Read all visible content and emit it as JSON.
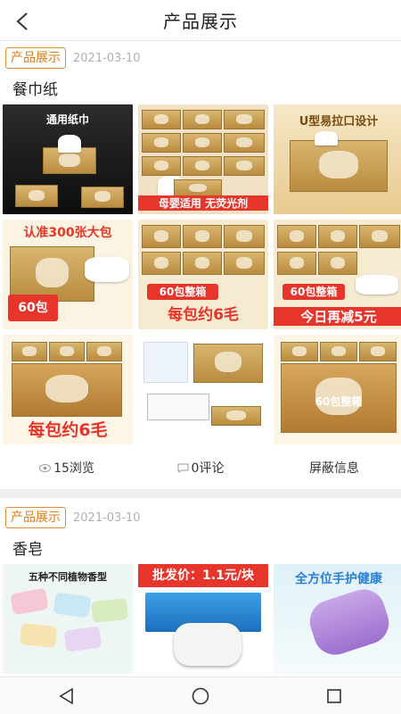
{
  "header": {
    "title": "产品展示",
    "back_icon": "chevron-left-icon"
  },
  "posts": [
    {
      "tag": "产品展示",
      "date": "2021-03-10",
      "title": "餐巾纸",
      "images": [
        {
          "caption": "通用纸巾"
        },
        {
          "caption": "母婴适用 无荧光剂"
        },
        {
          "caption": "U型易拉口设计"
        },
        {
          "caption": "认准300张大包"
        },
        {
          "caption": "每包约6毛"
        },
        {
          "caption": "今日再减5元"
        },
        {
          "caption": "每包约6毛"
        },
        {
          "caption": ""
        },
        {
          "caption": "60包整箱"
        }
      ],
      "stats": {
        "views": "15浏览",
        "comments": "0评论",
        "block": "屏蔽信息"
      }
    },
    {
      "tag": "产品展示",
      "date": "2021-03-10",
      "title": "香皂",
      "images": [
        {
          "caption": "五种不同植物香型"
        },
        {
          "caption": "批发价：1.1元/块"
        },
        {
          "caption": "全方位手护健康"
        }
      ]
    }
  ],
  "nav": {
    "back": "triangle-back-icon",
    "home": "circle-home-icon",
    "recents": "square-recents-icon"
  },
  "colors": {
    "accent": "#e07a12",
    "red": "#e8352b",
    "blue": "#2a7fd8"
  }
}
